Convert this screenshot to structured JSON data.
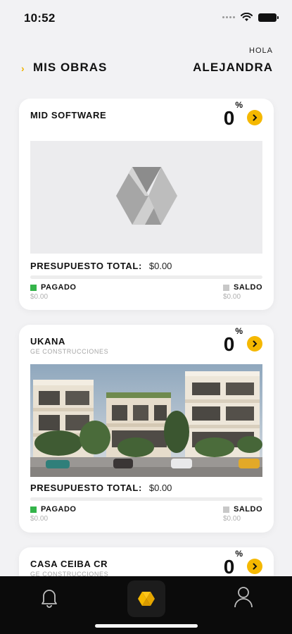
{
  "status_bar": {
    "time": "10:52"
  },
  "header": {
    "title": "MIS OBRAS",
    "greeting": "HOLA",
    "user_name": "ALEJANDRA"
  },
  "cards": [
    {
      "name": "MID SOFTWARE",
      "subtitle": "",
      "percent": "0",
      "percent_sign": "%",
      "budget_label": "PRESUPUESTO TOTAL:",
      "budget_value": "$0.00",
      "paid_label": "PAGADO",
      "paid_value": "$0.00",
      "balance_label": "SALDO",
      "balance_value": "$0.00",
      "progress": 0,
      "media": "logo-placeholder"
    },
    {
      "name": "UKANA",
      "subtitle": "GE CONSTRUCCIONES",
      "percent": "0",
      "percent_sign": "%",
      "budget_label": "PRESUPUESTO TOTAL:",
      "budget_value": "$0.00",
      "paid_label": "PAGADO",
      "paid_value": "$0.00",
      "balance_label": "SALDO",
      "balance_value": "$0.00",
      "progress": 0,
      "media": "building-photo"
    },
    {
      "name": "CASA CEIBA CR",
      "subtitle": "GE CONSTRUCCIONES",
      "percent": "0",
      "percent_sign": "%"
    }
  ],
  "tab_bar": {
    "items": [
      "bell-icon",
      "home-logo-icon",
      "profile-icon"
    ],
    "active": "home-logo-icon"
  },
  "colors": {
    "accent": "#f5b800",
    "paid": "#34b44a",
    "balance": "#c8c8c8",
    "tab_bar": "#0b0b0b"
  }
}
